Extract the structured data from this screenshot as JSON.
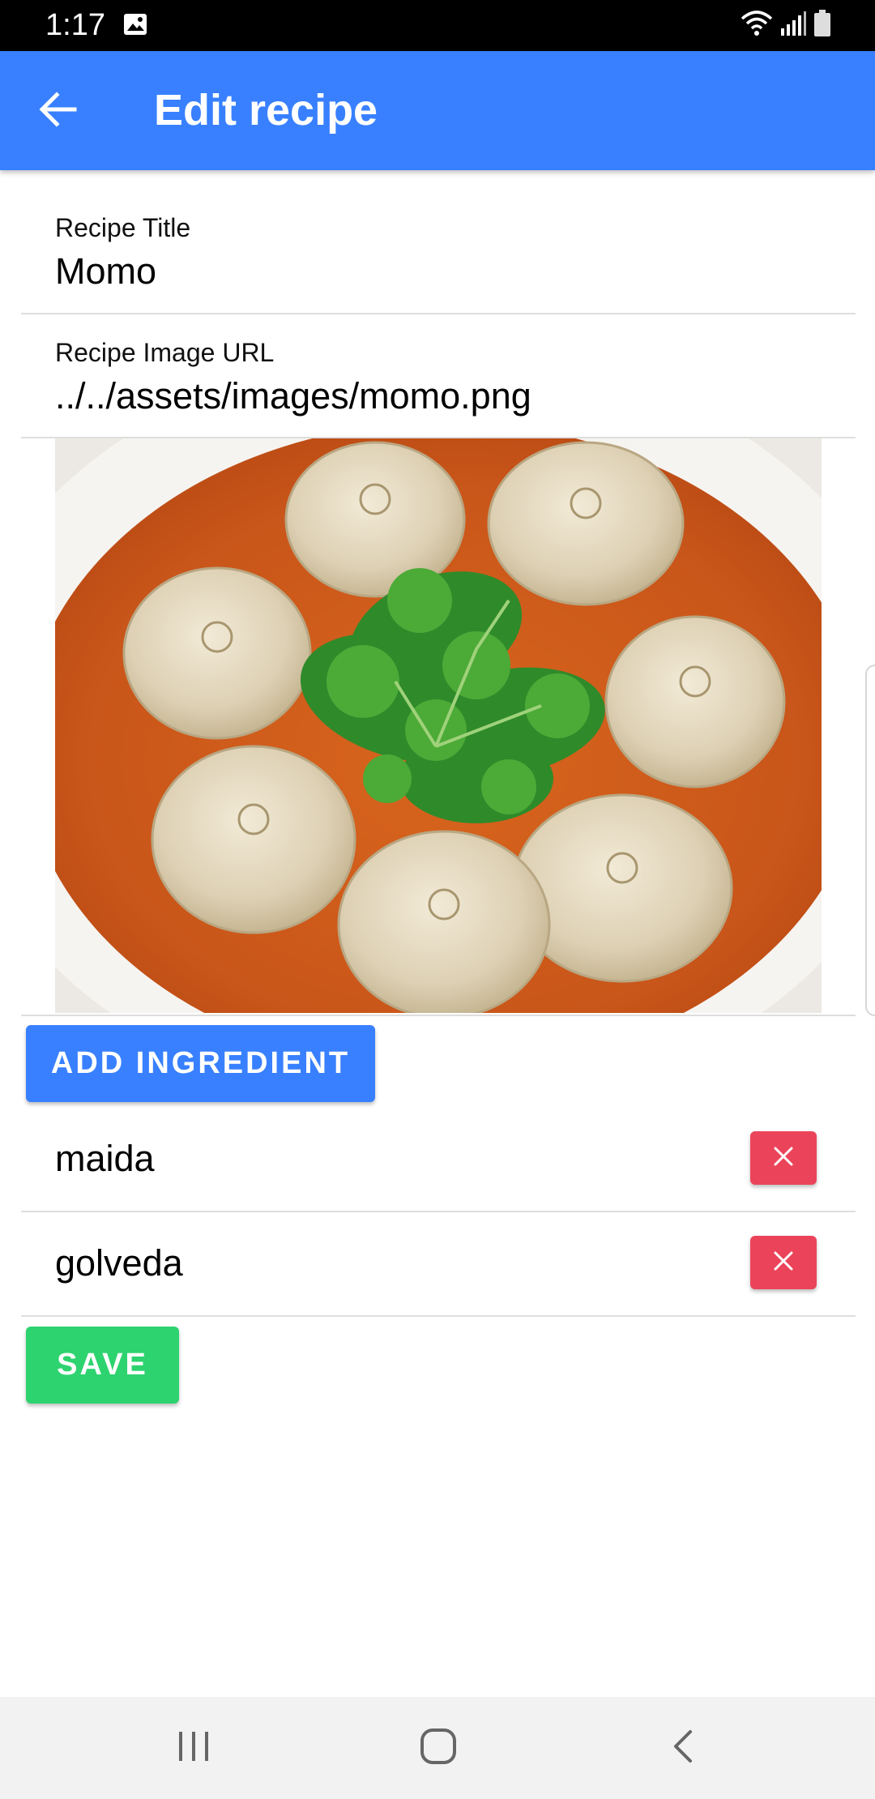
{
  "status_bar": {
    "time": "1:17",
    "icons": [
      "gallery-icon",
      "wifi-icon",
      "signal-icon",
      "battery-icon"
    ]
  },
  "app_bar": {
    "back_icon": "arrow-left-icon",
    "title": "Edit recipe",
    "background_color": "#3880ff"
  },
  "form": {
    "title_field": {
      "label": "Recipe Title",
      "value": "Momo"
    },
    "image_url_field": {
      "label": "Recipe Image URL",
      "value": "../../assets/images/momo.png"
    },
    "image_alt": "Momo"
  },
  "actions": {
    "add_ingredient_label": "ADD INGREDIENT",
    "add_ingredient_color": "#3880ff",
    "save_label": "SAVE",
    "save_color": "#2dd36f"
  },
  "ingredients": [
    {
      "name": "maida",
      "delete_icon": "close-icon"
    },
    {
      "name": "golveda",
      "delete_icon": "close-icon"
    }
  ],
  "delete_button_color": "#eb445a",
  "nav_bar": {
    "icons": [
      "recent-apps-icon",
      "home-icon",
      "back-icon"
    ]
  }
}
